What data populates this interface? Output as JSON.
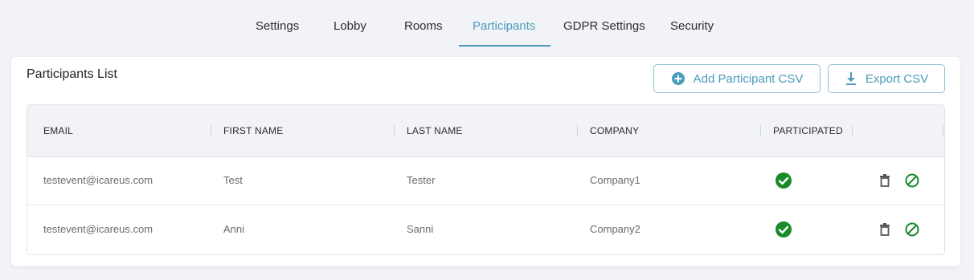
{
  "tabs": [
    {
      "label": "Settings"
    },
    {
      "label": "Lobby"
    },
    {
      "label": "Rooms"
    },
    {
      "label": "Participants",
      "active": true
    },
    {
      "label": "GDPR Settings"
    },
    {
      "label": "Security"
    }
  ],
  "card": {
    "title": "Participants List",
    "add_button": "Add Participant CSV",
    "export_button": "Export CSV"
  },
  "table": {
    "columns": [
      "EMAIL",
      "FIRST NAME",
      "LAST NAME",
      "COMPANY",
      "PARTICIPATED"
    ],
    "rows": [
      {
        "email": "testevent@icareus.com",
        "first_name": "Test",
        "last_name": "Tester",
        "company": "Company1",
        "participated": true
      },
      {
        "email": "testevent@icareus.com",
        "first_name": "Anni",
        "last_name": "Sanni",
        "company": "Company2",
        "participated": true
      }
    ]
  },
  "colors": {
    "accent": "#4a9cbb",
    "success": "#1a8a2a",
    "background": "#f2f3f6"
  },
  "icons": {
    "add": "plus-circle-icon",
    "export": "download-icon",
    "participated": "check-circle-icon",
    "delete": "trash-icon",
    "block": "ban-icon"
  }
}
